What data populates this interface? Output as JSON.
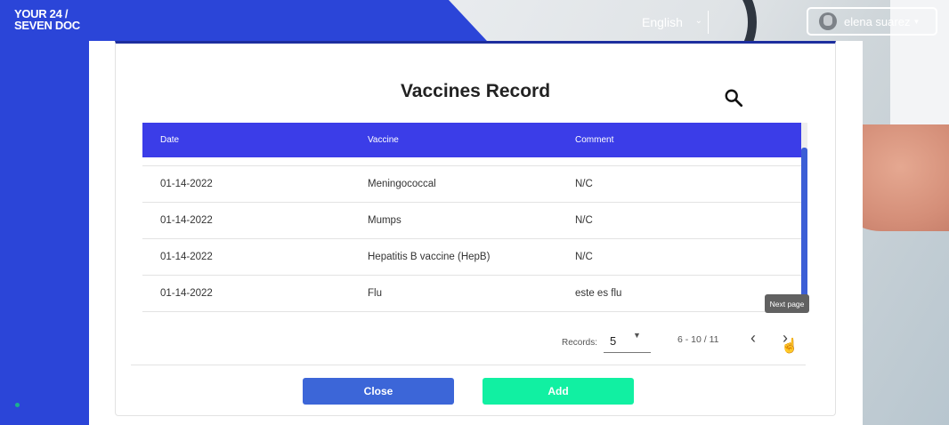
{
  "logo": {
    "line1": "YOUR 24 /",
    "line2": "SEVEN DOC"
  },
  "header": {
    "language": "English",
    "user_name": "elena suarez"
  },
  "modal": {
    "title": "Vaccines Record",
    "columns": [
      "Date",
      "Vaccine",
      "Comment"
    ],
    "rows": [
      {
        "date": "01-14-2022",
        "vaccine": "Meningococcal",
        "comment": "N/C"
      },
      {
        "date": "01-14-2022",
        "vaccine": "Mumps",
        "comment": "N/C"
      },
      {
        "date": "01-14-2022",
        "vaccine": "Hepatitis B vaccine (HepB)",
        "comment": "N/C"
      },
      {
        "date": "01-14-2022",
        "vaccine": "Flu",
        "comment": "este es flu"
      }
    ],
    "pagination": {
      "records_label": "Records:",
      "records_value": "5",
      "range": "6 - 10 / 11",
      "tooltip": "Next page"
    },
    "buttons": {
      "close": "Close",
      "add": "Add"
    }
  },
  "colors": {
    "primary_blue": "#2b45d8",
    "table_header": "#3b3de8",
    "close_button": "#3c66d8",
    "add_button": "#11f0a2"
  },
  "icons": [
    "search-icon",
    "chevron-left-icon",
    "chevron-right-icon",
    "caret-down-icon",
    "avatar-icon"
  ]
}
